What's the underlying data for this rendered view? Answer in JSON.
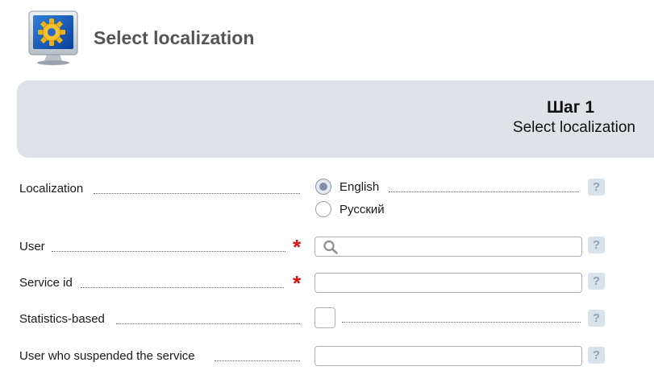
{
  "header": {
    "title": "Select localization",
    "icon": "monitor-gear-icon"
  },
  "step": {
    "title": "Шаг 1",
    "subtitle": "Select localization"
  },
  "form": {
    "localization": {
      "label": "Localization",
      "options": [
        {
          "label": "English",
          "selected": true
        },
        {
          "label": "Русский",
          "selected": false
        }
      ]
    },
    "user": {
      "label": "User",
      "required_marker": "*",
      "value": "",
      "icon": "search-icon"
    },
    "service_id": {
      "label": "Service id",
      "required_marker": "*",
      "value": ""
    },
    "statistics_based": {
      "label": "Statistics-based",
      "checked": false
    },
    "suspended_by": {
      "label": "User who suspended the service",
      "value": ""
    },
    "help_glyph": "?"
  },
  "colors": {
    "banner": "#dfe3e8",
    "required": "#e01010",
    "title": "#555555",
    "help_bg": "#d8e2ea"
  }
}
